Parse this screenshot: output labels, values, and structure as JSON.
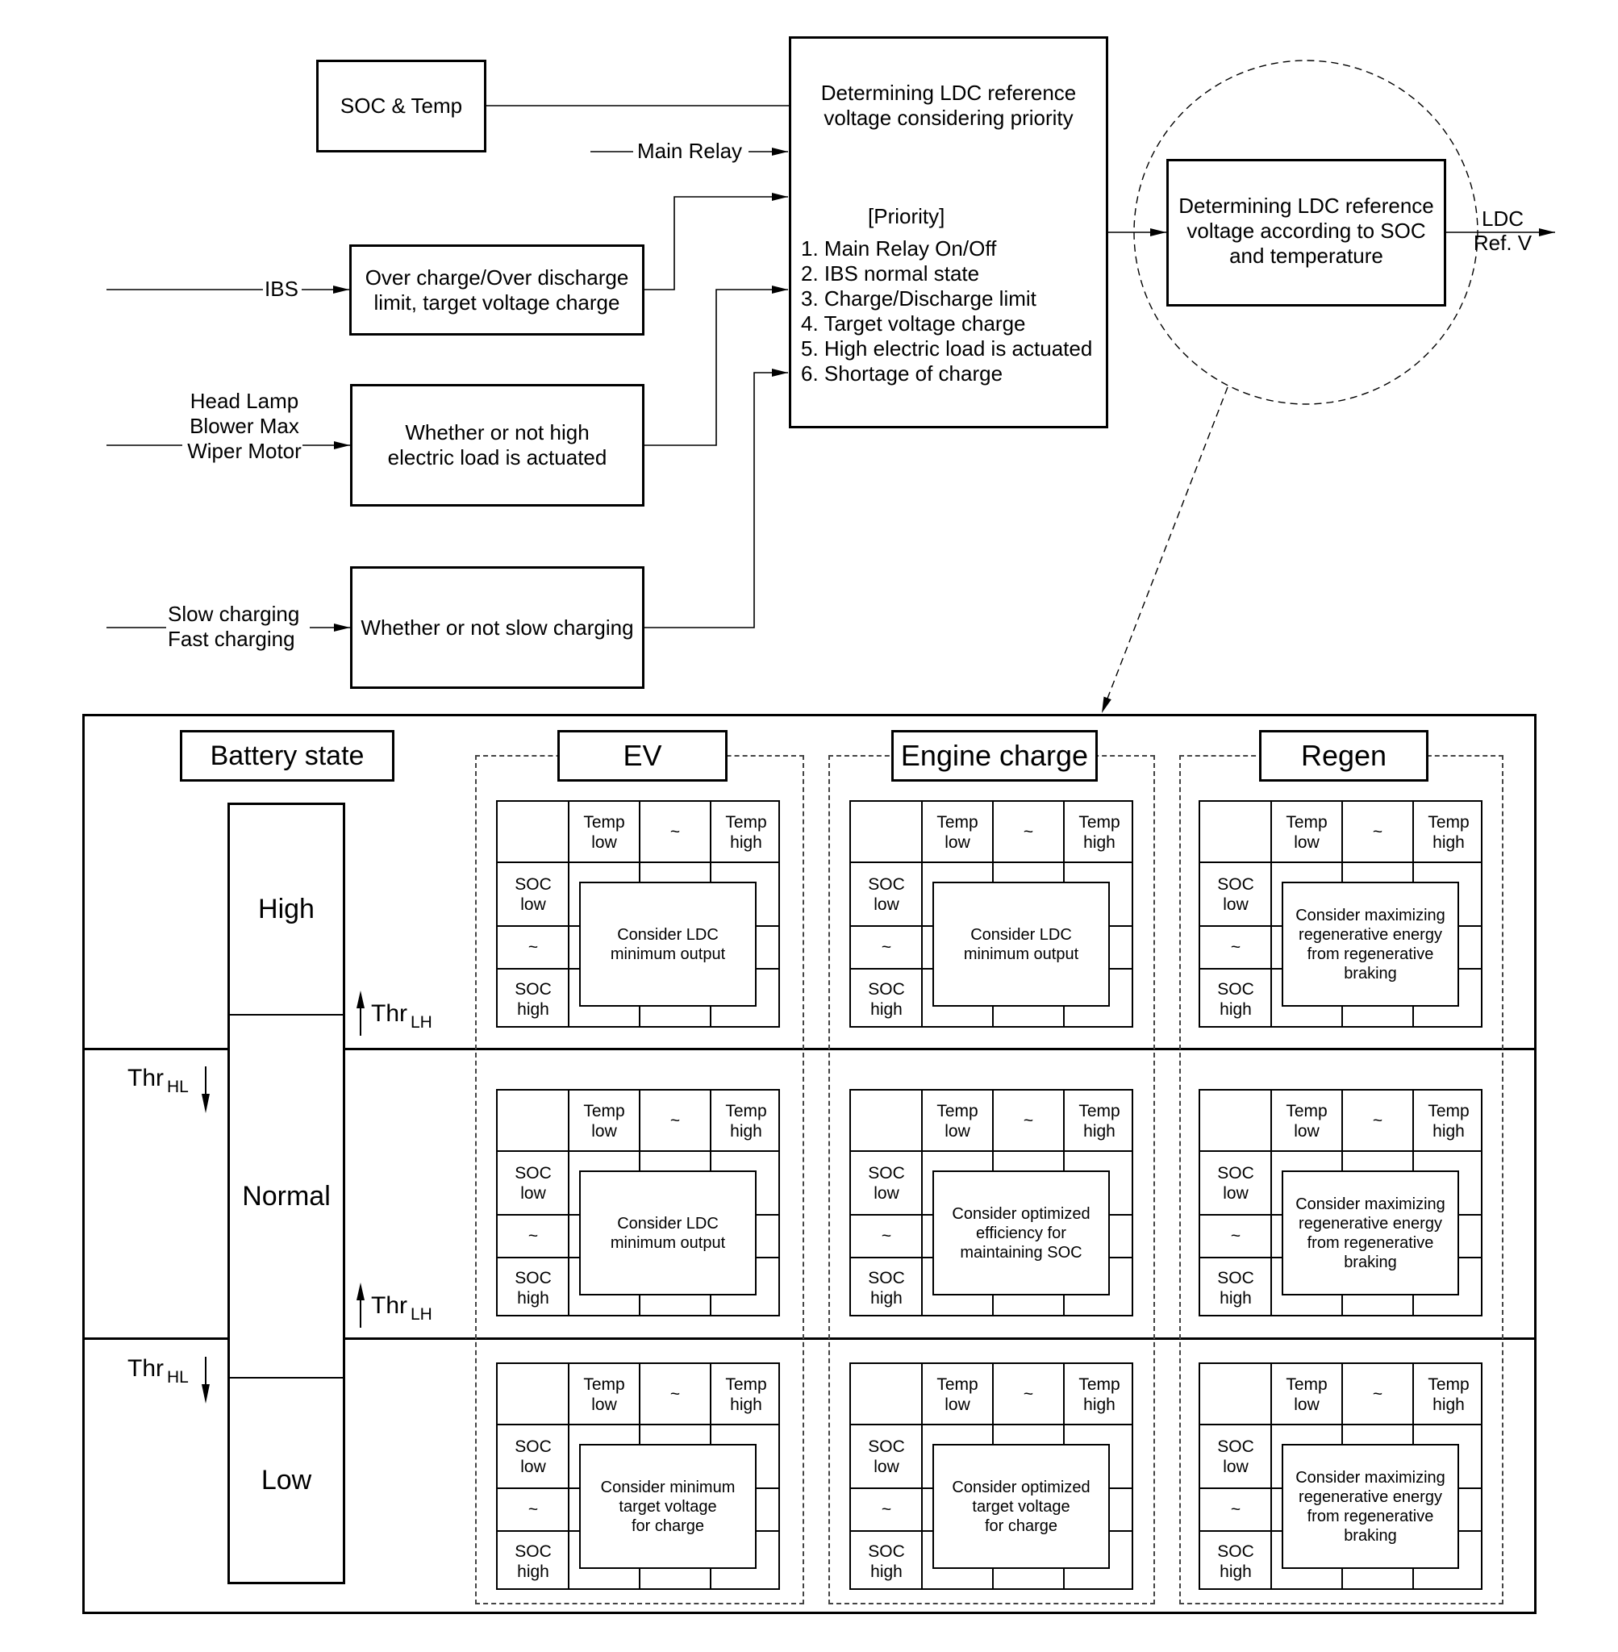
{
  "inputs": {
    "soc_temp": "SOC & Temp",
    "main_relay": "Main Relay",
    "ibs": "IBS",
    "loads": [
      "Head Lamp",
      "Blower Max",
      "Wiper Motor"
    ],
    "charging": [
      "Slow charging",
      "Fast charging"
    ]
  },
  "blocks": {
    "overcharge": [
      "Over charge/Over discharge",
      "limit, target voltage charge"
    ],
    "high_load": [
      "Whether or not high",
      "electric load is actuated"
    ],
    "slow_charging": "Whether or not slow charging",
    "priority_block": {
      "title": [
        "Determining LDC reference",
        "voltage considering priority"
      ],
      "priority_heading": "[Priority]",
      "priorities": [
        "1. Main Relay On/Off",
        "2. IBS normal state",
        "3. Charge/Discharge limit",
        "4. Target voltage charge",
        "5. High electric load is actuated",
        "6. Shortage of charge"
      ]
    },
    "soc_temp_block": [
      "Determining LDC reference",
      "voltage according to SOC",
      "and temperature"
    ],
    "output_label": [
      "LDC",
      "Ref. V"
    ]
  },
  "table": {
    "battery_state_label": "Battery state",
    "battery_states": [
      "High",
      "Normal",
      "Low"
    ],
    "threshold_up": {
      "main": "Thr",
      "sub": "LH"
    },
    "threshold_down": {
      "main": "Thr",
      "sub": "HL"
    },
    "modes": [
      "EV",
      "Engine charge",
      "Regen"
    ],
    "grid_headers": {
      "columns": [
        [
          "Temp",
          "low"
        ],
        [
          "~"
        ],
        [
          "Temp",
          "high"
        ]
      ],
      "rows": [
        [
          "SOC",
          "low"
        ],
        [
          "~"
        ],
        [
          "SOC",
          "high"
        ]
      ]
    },
    "cells": [
      [
        [
          "Consider LDC",
          "minimum output"
        ],
        [
          "Consider LDC",
          "minimum output"
        ],
        [
          "Consider maximizing",
          "regenerative energy",
          "from regenerative",
          "braking"
        ]
      ],
      [
        [
          "Consider LDC",
          "minimum output"
        ],
        [
          "Consider optimized",
          "efficiency for",
          "maintaining SOC"
        ],
        [
          "Consider maximizing",
          "regenerative energy",
          "from regenerative",
          "braking"
        ]
      ],
      [
        [
          "Consider minimum",
          "target voltage",
          "for charge"
        ],
        [
          "Consider optimized",
          "target voltage",
          "for charge"
        ],
        [
          "Consider maximizing",
          "regenerative energy",
          "from regenerative",
          "braking"
        ]
      ]
    ]
  }
}
